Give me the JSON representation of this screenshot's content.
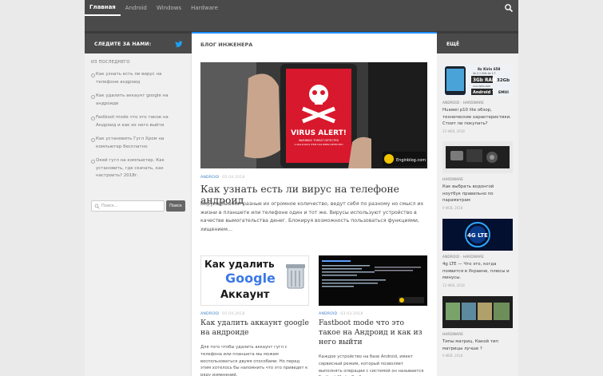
{
  "nav": {
    "items": [
      "Главная",
      "Android",
      "Windows",
      "Hardware"
    ]
  },
  "header": {
    "follow_label": "СЛЕДИТЕ ЗА НАМИ:",
    "blog_title": "БЛОГ ИНЖЕНЕРА",
    "more_label": "ЕЩЁ"
  },
  "sidebar": {
    "heading": "ИЗ ПОСЛЕДНЕГО",
    "recent": [
      "Как узнать есть ли вирус на телефоне андроид",
      "Как удалить аккаунт google на андроиде",
      "Fastboot mode что это такое на Андроид и как из него выйти",
      "Как установить Гугл Хром на компьютер бесплатно",
      "Окей гугл на компьютер. Как установить, где скачать, как настроить? 2018г."
    ],
    "search_placeholder": "Поиск...",
    "search_button": "Поиск"
  },
  "featured": {
    "category": "ANDROID",
    "date": "05.04.2018",
    "title": "Как узнать есть ли вирус на телефоне андроид",
    "excerpt": "Вирусы бывают разные их огромное количество, ведут себя по разному но смысл их жизни в планшете или телефоне один и тот же. Вирусы используют устройство в качестве вымогательства денег. Блокируя возможность пользоваться функциями, хищением…",
    "image_text": {
      "alert": "VIRUS ALERT!",
      "warning1": "WARNING! THREAT DETECTED",
      "warning2": "A MALICIOUS ITEM HAS BEEN DETECTED",
      "logo": "Enginblog.com"
    }
  },
  "cards": [
    {
      "category": "ANDROID",
      "date": "05.04.2018",
      "title": "Как удалить аккаунт google на андроиде",
      "excerpt": "Для того чтобы удалить аккаунт гугл с телефона или планшета мы можем воспользоваться двумя способами. Но перед этим хотелось бы напомнить что это приведет к ряду изменений.",
      "image_text": {
        "line1": "Как удалить",
        "line2": "Google",
        "line3": "Аккаунт"
      }
    },
    {
      "category": "ANDROID",
      "date": "03.03.2018",
      "title": "Fastboot mode что это такое на Андроид и как из него выйти",
      "excerpt": "Каждое устройство на базе Android, имеет сервисный режим, который позволяет выполнять операции с системой он называется Fastboot Mode. Разберемся, что такое"
    }
  ],
  "right_posts": [
    {
      "category": "ANDROID · HARDWARE",
      "title": "Huawei p10 lite обзор, технические характеристики. Стоит ли покупать?",
      "date": "22 ФЕВ, 2018",
      "image_text": [
        "8x Kirin 658",
        "4x 2.1 GHz 4x 1.7",
        "3Gb RAM",
        "32Gb",
        "microSIM+SIM",
        "Android 7",
        "EMUI"
      ]
    },
    {
      "category": "HARDWARE",
      "title": "Как выбрать водонгой ноутбук правильно по параметрам",
      "date": "9 ФЕВ, 2018"
    },
    {
      "category": "ANDROID · HARDWARE",
      "title": "4g LTE — Что это, когда появится в Украине, плюсы и минусы.",
      "date": "12 ФЕВ, 2018",
      "image_text": "4G LTE"
    },
    {
      "category": "HARDWARE",
      "title": "Типы матриц. Какой тип матрицы лучше ?",
      "date": "9 ФЕВ, 2018"
    }
  ],
  "colors": {
    "dark_header": "#4a4a4a",
    "accent_blue": "#3a7fc6",
    "alert_red": "#d8182c"
  }
}
